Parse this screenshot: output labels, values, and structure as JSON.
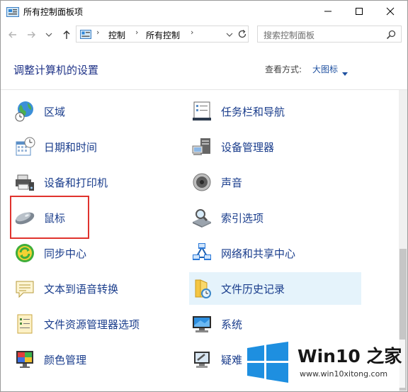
{
  "window": {
    "title": "所有控制面板项"
  },
  "address": {
    "crumbs": [
      "控制",
      "所有控制"
    ],
    "separator": "›"
  },
  "search": {
    "placeholder": "搜索控制面板"
  },
  "header": {
    "title": "调整计算机的设置",
    "view_label": "查看方式:",
    "view_value": "大图标"
  },
  "items": [
    {
      "label": "区域",
      "icon": "globe-clock-icon"
    },
    {
      "label": "任务栏和导航",
      "icon": "taskbar-icon"
    },
    {
      "label": "日期和时间",
      "icon": "calendar-clock-icon"
    },
    {
      "label": "设备管理器",
      "icon": "device-manager-icon"
    },
    {
      "label": "设备和打印机",
      "icon": "printer-icon"
    },
    {
      "label": "声音",
      "icon": "speaker-icon"
    },
    {
      "label": "鼠标",
      "icon": "mouse-icon"
    },
    {
      "label": "索引选项",
      "icon": "index-search-icon"
    },
    {
      "label": "同步中心",
      "icon": "sync-icon"
    },
    {
      "label": "网络和共享中心",
      "icon": "network-icon"
    },
    {
      "label": "文本到语音转换",
      "icon": "speech-bubble-icon"
    },
    {
      "label": "文件历史记录",
      "icon": "file-history-icon"
    },
    {
      "label": "文件资源管理器选项",
      "icon": "folder-options-icon"
    },
    {
      "label": "系统",
      "icon": "system-monitor-icon"
    },
    {
      "label": "颜色管理",
      "icon": "color-management-icon"
    },
    {
      "label": "疑难",
      "icon": "troubleshoot-icon"
    }
  ],
  "watermark": {
    "title": "Win10 之家",
    "url": "www.win10xitong.com"
  },
  "colors": {
    "link": "#1a3d8c",
    "title": "#1e3287",
    "highlight": "#e5f3fb",
    "callout": "#e0332e"
  }
}
